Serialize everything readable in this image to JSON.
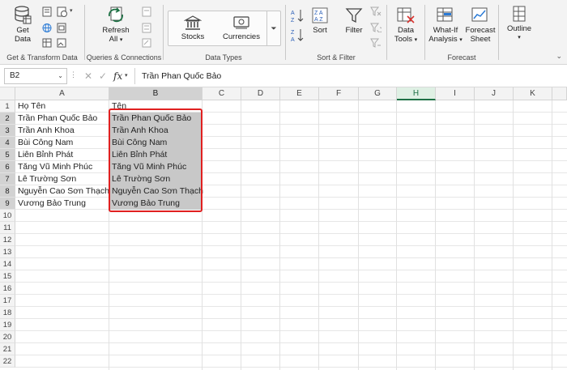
{
  "ribbon": {
    "get_data": "Get",
    "get_data2": "Data",
    "refresh": "Refresh",
    "refresh2": "All",
    "stocks": "Stocks",
    "currencies": "Currencies",
    "sort": "Sort",
    "filter": "Filter",
    "data_tools": "Data",
    "data_tools2": "Tools",
    "whatif": "What-If",
    "whatif2": "Analysis",
    "forecast": "Forecast",
    "forecast2": "Sheet",
    "outline": "Outline",
    "groups": {
      "get_transform": "Get & Transform Data",
      "queries": "Queries & Connections",
      "data_types": "Data Types",
      "sort_filter": "Sort & Filter",
      "forecast": "Forecast"
    }
  },
  "formula_bar": {
    "name_box": "B2",
    "fx": "fx",
    "formula": "Trần Phan Quốc Bảo"
  },
  "columns": [
    "A",
    "B",
    "C",
    "D",
    "E",
    "F",
    "G",
    "H",
    "I",
    "J",
    "K"
  ],
  "rows": [
    "1",
    "2",
    "3",
    "4",
    "5",
    "6",
    "7",
    "8",
    "9",
    "10",
    "11",
    "12",
    "13",
    "14",
    "15",
    "16",
    "17",
    "18",
    "19",
    "20",
    "21",
    "22"
  ],
  "cells": {
    "A": [
      "Họ Tên",
      "Trần Phan Quốc Bảo",
      "Trần Anh Khoa",
      "Bùi Công Nam",
      "Liên Bỉnh Phát",
      "Tăng Vũ Minh Phúc",
      "Lê Trường Sơn",
      "Nguyễn Cao Sơn Thạch",
      "Vương Bảo Trung"
    ],
    "B": [
      "Tên",
      "Trần Phan Quốc Bảo",
      "Trần Anh Khoa",
      "Bùi Công Nam",
      "Liên Bỉnh Phát",
      "Tăng Vũ Minh Phúc",
      "Lê Trường Sơn",
      "Nguyễn Cao Sơn Thạch",
      "Vương Bảo Trung"
    ]
  },
  "colors": {
    "accent_green": "#1e7145",
    "highlight_red": "#e02020",
    "selection_gray": "#c8c8c8"
  }
}
